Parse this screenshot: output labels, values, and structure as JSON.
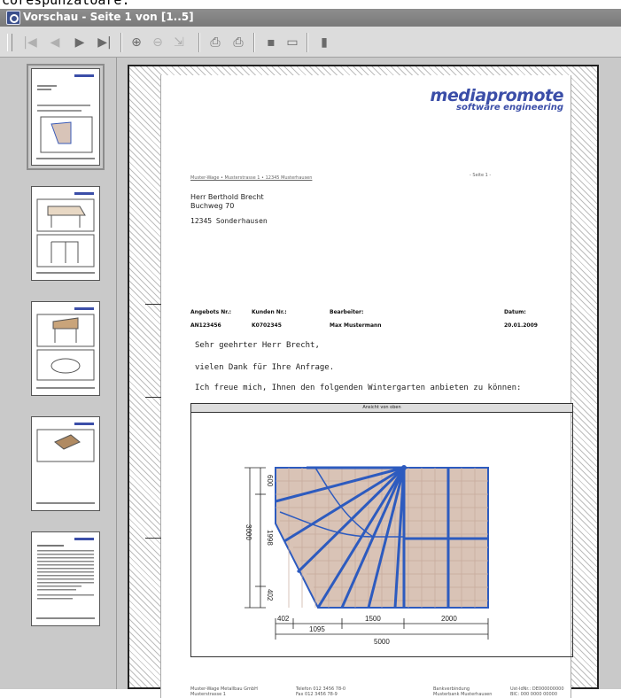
{
  "window": {
    "cut_text": "corespunzatoare.",
    "title": "Vorschau - Seite 1 von [1..5]"
  },
  "toolbar": {
    "buttons": [
      {
        "name": "first-page-button",
        "glyph": "|◀",
        "enabled": false
      },
      {
        "name": "prev-page-button",
        "glyph": "◀",
        "enabled": false
      },
      {
        "name": "next-page-button",
        "glyph": "▶",
        "enabled": true
      },
      {
        "name": "last-page-button",
        "glyph": "▶|",
        "enabled": true
      },
      {
        "name": "zoom-in-button",
        "glyph": "⊕",
        "enabled": true
      },
      {
        "name": "zoom-out-button",
        "glyph": "⊖",
        "enabled": false
      },
      {
        "name": "zoom-fit-button",
        "glyph": "⇲",
        "enabled": false
      },
      {
        "name": "print-button",
        "glyph": "⎙",
        "enabled": true
      },
      {
        "name": "print-setup-button",
        "glyph": "⎙",
        "enabled": true
      },
      {
        "name": "save-button",
        "glyph": "▪",
        "enabled": true
      },
      {
        "name": "export-button",
        "glyph": "▭",
        "enabled": true
      },
      {
        "name": "close-preview-button",
        "glyph": "▮",
        "enabled": true
      }
    ]
  },
  "thumbnails": {
    "count": 5,
    "selected_page": 1
  },
  "page": {
    "logo_main": "mediapromote",
    "logo_sub": "software engineering",
    "sender_line": "Muster-Wage • Musterstrasse 1 • 12345 Musterhausen",
    "page_label": "- Seite 1 -",
    "recipient_name": "Herr Berthold Brecht",
    "recipient_street": "Buchweg 70",
    "recipient_city": "12345 Sonderhausen",
    "meta": [
      {
        "label": "Angebots Nr.:",
        "value": "AN123456"
      },
      {
        "label": "Kunden Nr.:",
        "value": "K0702345"
      },
      {
        "label": "Bearbeiter:",
        "value": "Max Mustermann"
      },
      {
        "label": "Datum:",
        "value": "20.01.2009"
      }
    ],
    "salutation": "Sehr geehrter Herr Brecht,",
    "thanks": "vielen Dank für Ihre Anfrage.",
    "offer": "Ich freue mich, Ihnen den folgenden Wintergarten anbieten zu können:",
    "figure_title": "Ansicht von oben",
    "dimensions": {
      "bottom": [
        "402",
        "1095",
        "1500",
        "2000"
      ],
      "bottom_total": "5000",
      "left": [
        "600",
        "1998",
        "402"
      ],
      "left_total": "3000"
    },
    "footer": [
      {
        "l1": "Muster-Wage Metallbau GmbH",
        "l2": "Musterstrasse 1"
      },
      {
        "l1": "Telefon     012 3456 78-0",
        "l2": "Fax         012 3456 78-9"
      },
      {
        "l1": "Bankverbindung",
        "l2": "Musterbank Musterhausen"
      },
      {
        "l1": "Ust-IdNr.: DE000000000",
        "l2": "BIC: 000 0000 00000"
      }
    ]
  }
}
